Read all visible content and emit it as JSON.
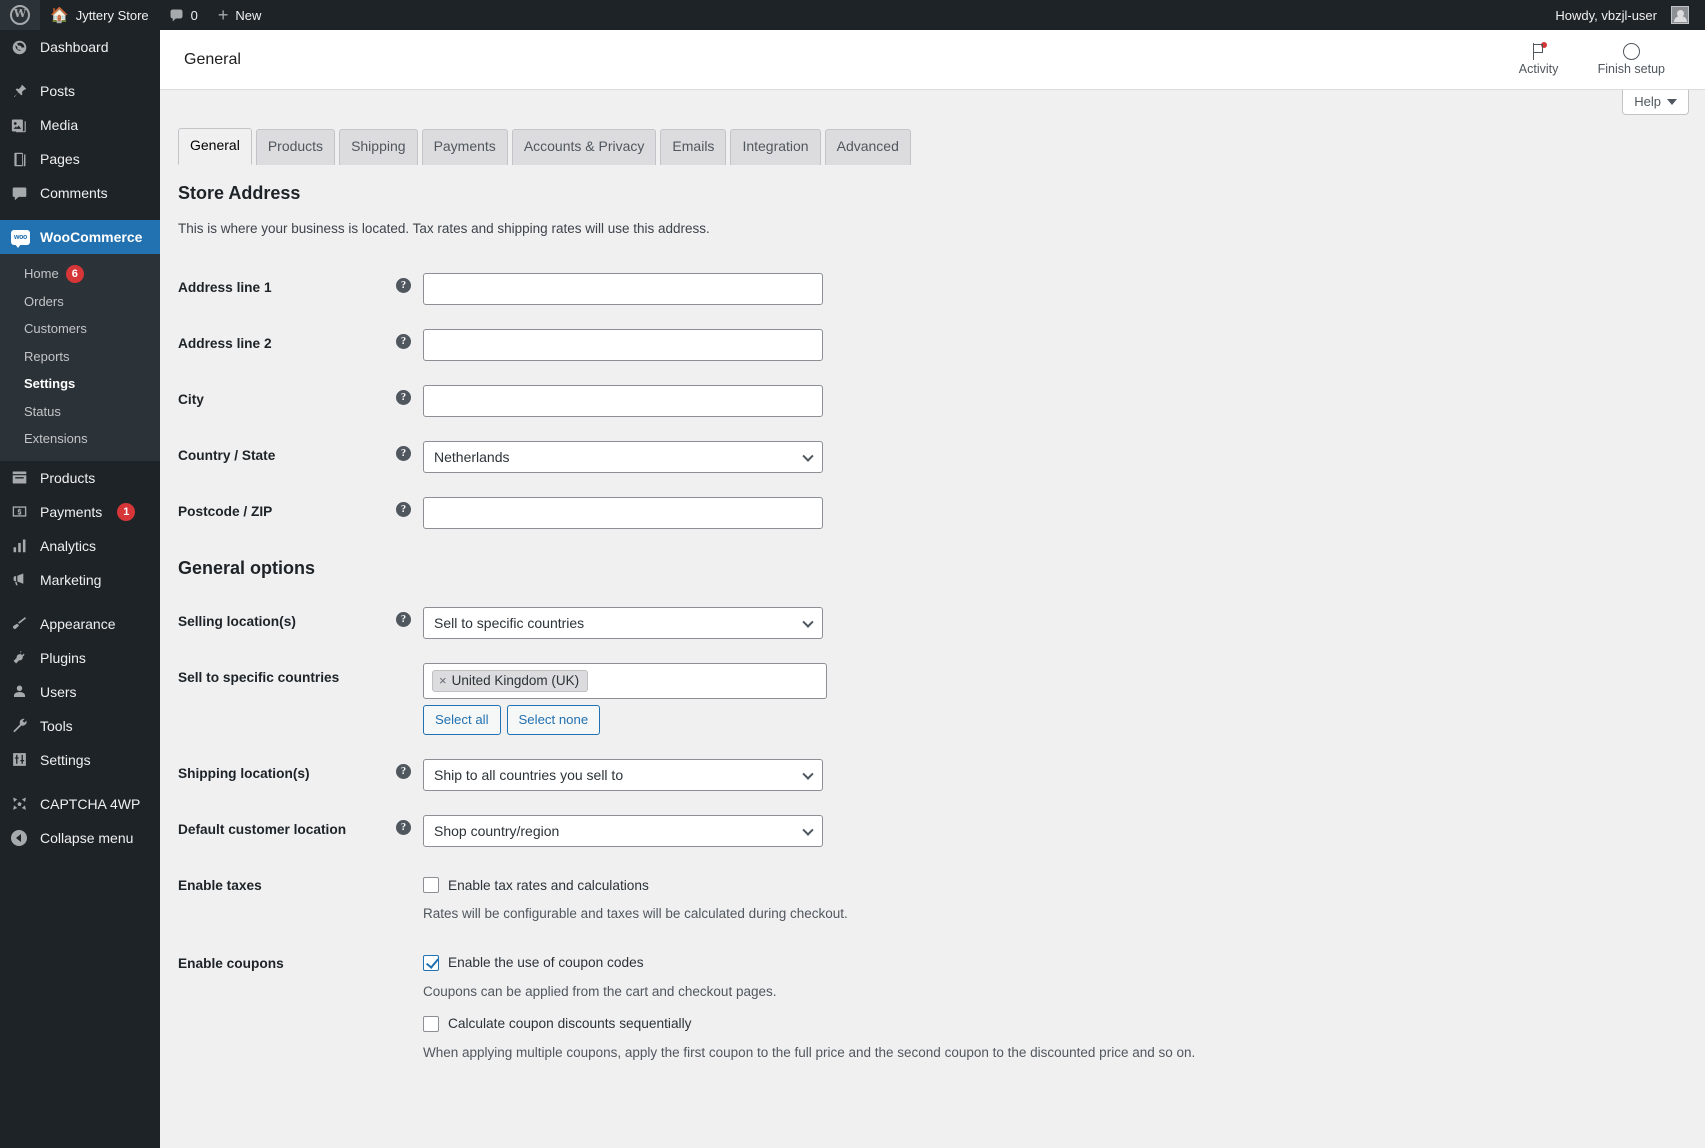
{
  "adminbar": {
    "logo_icon": "wordpress-logo-icon",
    "home_icon": "home-icon",
    "site_name": "Jyttery Store",
    "comments_icon": "comment-bubble-icon",
    "comments_count": "0",
    "new_icon": "plus-icon",
    "new_label": "New",
    "howdy": "Howdy, vbzjl-user",
    "avatar_icon": "avatar-icon"
  },
  "sidebar": {
    "items": [
      {
        "label": "Dashboard",
        "icon": "dashboard-icon",
        "current": false
      },
      {
        "label": "Posts",
        "icon": "pin-icon",
        "current": false
      },
      {
        "label": "Media",
        "icon": "media-icon",
        "current": false
      },
      {
        "label": "Pages",
        "icon": "pages-icon",
        "current": false
      },
      {
        "label": "Comments",
        "icon": "comments-icon",
        "current": false
      },
      {
        "label": "WooCommerce",
        "icon": "woocommerce-icon",
        "current": true
      },
      {
        "label": "Products",
        "icon": "products-icon",
        "current": false
      },
      {
        "label": "Payments",
        "icon": "payments-icon",
        "current": false,
        "badge": "1"
      },
      {
        "label": "Analytics",
        "icon": "analytics-bars-icon",
        "current": false
      },
      {
        "label": "Marketing",
        "icon": "megaphone-icon",
        "current": false
      },
      {
        "label": "Appearance",
        "icon": "paintbrush-icon",
        "current": false
      },
      {
        "label": "Plugins",
        "icon": "plug-icon",
        "current": false
      },
      {
        "label": "Users",
        "icon": "user-icon",
        "current": false
      },
      {
        "label": "Tools",
        "icon": "wrench-icon",
        "current": false
      },
      {
        "label": "Settings",
        "icon": "sliders-icon",
        "current": false
      },
      {
        "label": "CAPTCHA 4WP",
        "icon": "captcha-icon",
        "current": false
      }
    ],
    "woocommerce_submenu": [
      {
        "label": "Home",
        "badge": "6",
        "current": false
      },
      {
        "label": "Orders",
        "current": false
      },
      {
        "label": "Customers",
        "current": false
      },
      {
        "label": "Reports",
        "current": false
      },
      {
        "label": "Settings",
        "current": true
      },
      {
        "label": "Status",
        "current": false
      },
      {
        "label": "Extensions",
        "current": false
      }
    ],
    "collapse_label": "Collapse menu",
    "collapse_icon": "collapse-arrow-icon"
  },
  "wc_header": {
    "title": "General",
    "activity_label": "Activity",
    "activity_icon": "flag-icon",
    "finish_setup_label": "Finish setup",
    "finish_setup_icon": "progress-circle-icon",
    "help_label": "Help",
    "help_caret_icon": "chevron-down-icon"
  },
  "tabs": [
    {
      "label": "General",
      "active": true
    },
    {
      "label": "Products",
      "active": false
    },
    {
      "label": "Shipping",
      "active": false
    },
    {
      "label": "Payments",
      "active": false
    },
    {
      "label": "Accounts & Privacy",
      "active": false
    },
    {
      "label": "Emails",
      "active": false
    },
    {
      "label": "Integration",
      "active": false
    },
    {
      "label": "Advanced",
      "active": false
    }
  ],
  "store_address": {
    "heading": "Store Address",
    "description": "This is where your business is located. Tax rates and shipping rates will use this address.",
    "fields": {
      "address1_label": "Address line 1",
      "address1_value": "",
      "address2_label": "Address line 2",
      "address2_value": "",
      "city_label": "City",
      "city_value": "",
      "country_label": "Country / State",
      "country_value": "Netherlands",
      "postcode_label": "Postcode / ZIP",
      "postcode_value": ""
    }
  },
  "general_options": {
    "heading": "General options",
    "selling_locations_label": "Selling location(s)",
    "selling_locations_value": "Sell to specific countries",
    "sell_to_specific_label": "Sell to specific countries",
    "sell_to_specific_chips": [
      "United Kingdom (UK)"
    ],
    "chip_remove_icon": "remove-x-icon",
    "select_all_label": "Select all",
    "select_none_label": "Select none",
    "shipping_locations_label": "Shipping location(s)",
    "shipping_locations_value": "Ship to all countries you sell to",
    "default_customer_location_label": "Default customer location",
    "default_customer_location_value": "Shop country/region",
    "enable_taxes_label": "Enable taxes",
    "enable_taxes_checkbox_label": "Enable tax rates and calculations",
    "enable_taxes_checked": false,
    "enable_taxes_desc": "Rates will be configurable and taxes will be calculated during checkout.",
    "enable_coupons_label": "Enable coupons",
    "enable_coupons_checkbox_label": "Enable the use of coupon codes",
    "enable_coupons_checked": true,
    "enable_coupons_desc": "Coupons can be applied from the cart and checkout pages.",
    "sequential_coupons_checkbox_label": "Calculate coupon discounts sequentially",
    "sequential_coupons_checked": false,
    "sequential_coupons_desc": "When applying multiple coupons, apply the first coupon to the full price and the second coupon to the discounted price and so on."
  },
  "tooltip_glyph": "?",
  "colors": {
    "admin_bg": "#1d2327",
    "submenu_bg": "#2c3338",
    "accent_blue": "#2271b1",
    "badge_red": "#d63638",
    "content_bg": "#f0f0f1"
  }
}
